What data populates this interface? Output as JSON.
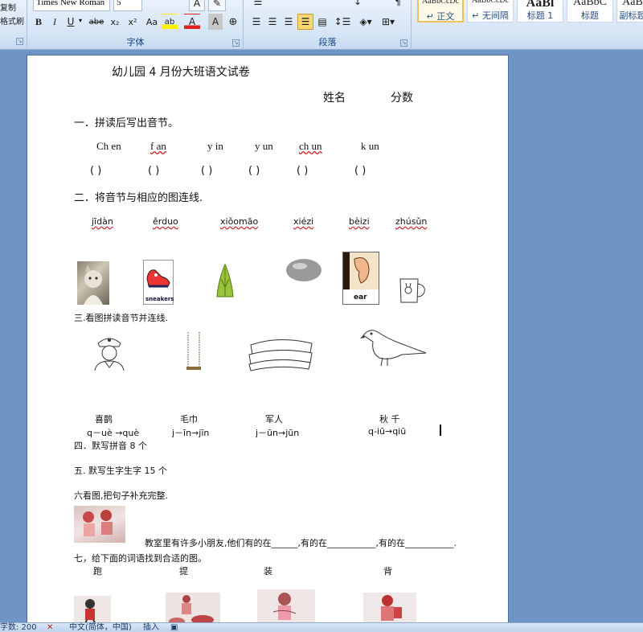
{
  "ribbon": {
    "clipboard": {
      "copy": "复制",
      "format_painter": "格式刷"
    },
    "font": {
      "group_label": "字体",
      "font_name": "Times New Roman",
      "font_size": "5",
      "bold": "B",
      "italic": "I",
      "underline": "U",
      "strike": "abe",
      "subscript": "x₂",
      "superscript": "x²",
      "change_case": "Aa",
      "highlight": "ab",
      "font_color": "A",
      "char_shade": "A",
      "enclose": "字"
    },
    "paragraph": {
      "group_label": "段落"
    },
    "styles": [
      {
        "sample": "AaBbCcDc",
        "name": "↵ 正文"
      },
      {
        "sample": "AaBbCcDc",
        "name": "↵ 无间隔"
      },
      {
        "sample": "AaBl",
        "name": "标题 1"
      },
      {
        "sample": "AaBbC",
        "name": "标题"
      },
      {
        "sample": "AaB",
        "name": "副标题"
      }
    ]
  },
  "document": {
    "title": "幼儿园 4 月份大班语文试卷",
    "name_label": "姓名",
    "score_label": "分数",
    "s1": {
      "heading": "一．拼读后写出音节。",
      "syllables": [
        "Ch en",
        "f  an",
        "y   in",
        "y un",
        "ch un",
        "k   un"
      ],
      "parens": [
        "(      )",
        "(     )",
        "(      )",
        "(      )",
        "(       )",
        "(        )"
      ]
    },
    "s2": {
      "heading": "二．将音节与相应的图连线.",
      "pinyin": [
        "jīdàn",
        "ěrduo",
        "xiǒomāo",
        "xiézi",
        "bèizi",
        "zhúsǔn"
      ],
      "image_caption_sneakers": "sneakers",
      "image_caption_ear": "ear"
    },
    "s3": {
      "heading": "三.看图拼读音节并连线.",
      "words": [
        "喜鹊",
        "毛巾",
        "军人",
        "秋  千"
      ],
      "pinyin": [
        "q－uè →què",
        "j－īn→jīn",
        "j－ūn→jūn",
        "q-iū→qiū"
      ]
    },
    "s4": {
      "heading": "四．默写拼音 8 个"
    },
    "s5": {
      "heading": "五. 默写生字生字 15 个"
    },
    "s6": {
      "heading": "六看图,把句子补充完整.",
      "sentence": "教室里有许多小朋友,他们有的在______,有的在___________,有的在___________."
    },
    "s7": {
      "heading": "七，给下面的词语找到合适的图。",
      "words": [
        "跑",
        "提",
        "装",
        "背"
      ]
    }
  },
  "status": {
    "word_count": "字数: 200",
    "language": "中文(简体，中国)",
    "mode": "插入"
  }
}
